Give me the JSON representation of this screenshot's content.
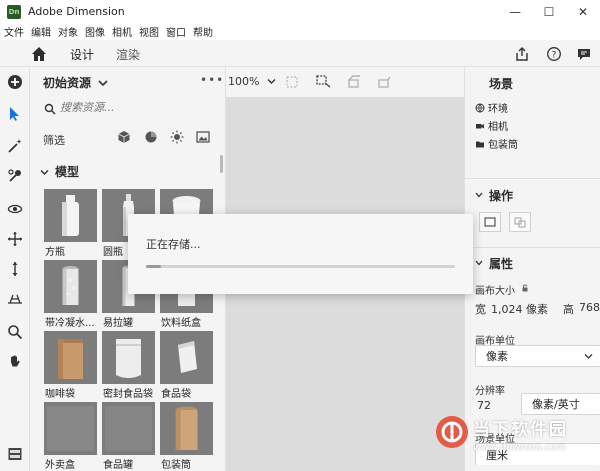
{
  "window": {
    "logo_text": "Dn",
    "title": "Adobe Dimension",
    "minimize": "—",
    "maximize": "☐",
    "close": "✕"
  },
  "menu": [
    "文件",
    "编辑",
    "对象",
    "图像",
    "相机",
    "视图",
    "窗口",
    "帮助"
  ],
  "toolbar": {
    "tabs": [
      {
        "label": "设计",
        "active": true
      },
      {
        "label": "渲染",
        "active": false
      }
    ],
    "right_icons": [
      "share-icon",
      "help-icon",
      "comment-icon"
    ]
  },
  "left_tools": [
    "add-icon",
    "select-icon",
    "magic-wand-icon",
    "sample-icon",
    "orbit-icon",
    "pan-icon",
    "dolly-icon",
    "horizon-icon",
    "zoom-icon",
    "hand-icon",
    "layers-icon"
  ],
  "assets": {
    "title": "初始资源",
    "more": "•••",
    "search_placeholder": "搜索资源...",
    "filter_label": "筛选",
    "filter_icons": [
      "model-filter-icon",
      "material-filter-icon",
      "light-filter-icon",
      "image-filter-icon"
    ],
    "section": "模型",
    "items": [
      {
        "label": "方瓶",
        "shape": "square-bottle"
      },
      {
        "label": "圆瓶",
        "shape": "round-bottle"
      },
      {
        "label": "",
        "shape": "cup"
      },
      {
        "label": "带冷凝水...",
        "shape": "can"
      },
      {
        "label": "易拉罐",
        "shape": "can-thin"
      },
      {
        "label": "饮料纸盒",
        "shape": "carton"
      },
      {
        "label": "咖啡袋",
        "shape": "coffee-bag"
      },
      {
        "label": "密封食品袋",
        "shape": "pouch"
      },
      {
        "label": "食品袋",
        "shape": "food-bag"
      },
      {
        "label": "外卖盒",
        "shape": "takeout"
      },
      {
        "label": "食品罐",
        "shape": "food-can"
      },
      {
        "label": "包装筒",
        "shape": "tube"
      }
    ]
  },
  "canvas": {
    "zoom": "100%"
  },
  "right_panel": {
    "scene_title": "场景",
    "scene_items": [
      {
        "label": "环境",
        "icon": "globe-icon"
      },
      {
        "label": "相机",
        "icon": "camera-icon"
      },
      {
        "label": "包装筒",
        "icon": "folder-icon"
      }
    ],
    "actions_title": "操作",
    "properties_title": "属性",
    "canvas_size_label": "画布大小",
    "width_label": "宽",
    "width_value": "1,024 像素",
    "height_label": "高",
    "height_value": "768",
    "canvas_unit_label": "画布单位",
    "canvas_unit_value": "像素",
    "resolution_label": "分辨率",
    "resolution_value": "72",
    "resolution_unit": "像素/英寸",
    "scene_unit_label": "场景单位",
    "scene_unit_value": "厘米"
  },
  "dialog": {
    "message": "正在存储...",
    "progress": 0.05
  },
  "watermark": {
    "title": "当下软件园",
    "url": "www.downxia.com"
  }
}
